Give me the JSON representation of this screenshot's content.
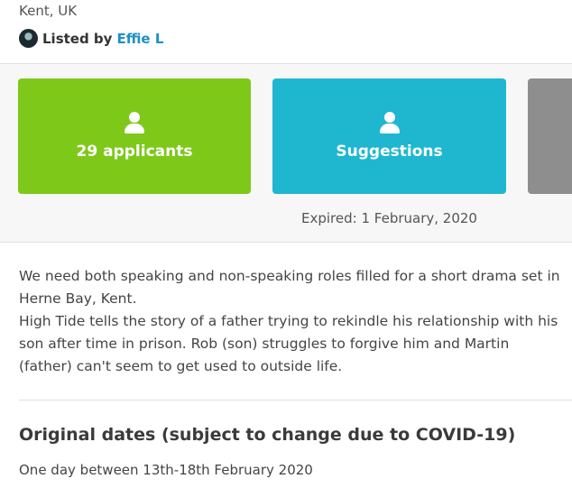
{
  "listing": {
    "location": "Kent, UK",
    "listed_by_label": "Listed by",
    "lister_name": "Effie L"
  },
  "tiles": {
    "applicants_label": "29 applicants",
    "suggestions_label": "Suggestions",
    "icon": "person-icon"
  },
  "status": {
    "expired_text": "Expired: 1 February, 2020"
  },
  "description": {
    "line1": "We need both speaking and non-speaking roles filled for a short drama set in Herne Bay, Kent.",
    "line2": "High Tide tells the story of a father trying to rekindle his relationship with his son after time in prison. Rob (son) struggles to forgive him and Martin (father) can't seem to get used to outside life."
  },
  "dates": {
    "title": "Original dates (subject to change due to COVID-19)",
    "text": "One day between 13th-18th February 2020"
  },
  "colors": {
    "applicants": "#7ec81a",
    "suggestions": "#1fb7cf",
    "more": "#8e8e8e",
    "link": "#1e8fc6"
  }
}
